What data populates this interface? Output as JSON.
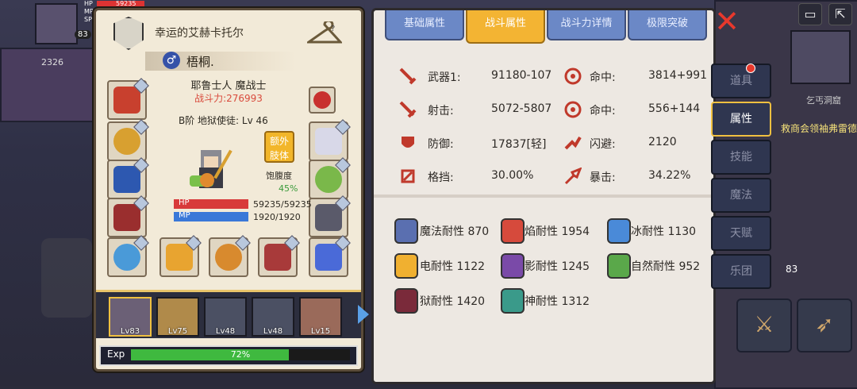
{
  "hud": {
    "hp_label": "HP",
    "mp_label": "MP",
    "sp_label": "SP",
    "hp_value": "59235",
    "level": "83",
    "coins": "2326"
  },
  "minimap": {
    "location": "乞丐洞窟",
    "quest": "救商会领袖弗雷德"
  },
  "character": {
    "title": "幸运的艾赫卡托尔",
    "gender_symbol": "♂",
    "name": "梧桐.",
    "race_class": "耶鲁士人 魔战士",
    "power": "战斗力:276993",
    "rank": "B阶 地狱使徒: Lv 46",
    "extra_button": [
      "额外",
      "肢体"
    ],
    "satiety_label": "饱腹度",
    "satiety_value": "45%",
    "hp_label": "HP",
    "hp": "59235/59235",
    "hp_ratio": 1.0,
    "mp_label": "MP",
    "mp": "1920/1920",
    "mp_ratio": 1.0
  },
  "party": {
    "members": [
      {
        "lv": "Lv83"
      },
      {
        "lv": "Lv75"
      },
      {
        "lv": "Lv48"
      },
      {
        "lv": "Lv48"
      },
      {
        "lv": "Lv15"
      }
    ]
  },
  "exp": {
    "label": "Exp",
    "percent": "72%",
    "ratio": 0.72
  },
  "tabs": [
    "基础属性",
    "战斗属性",
    "战斗力详情",
    "极限突破"
  ],
  "stats": [
    {
      "label": "武器1:",
      "value": "91180-107",
      "label2": "命中:",
      "value2": "3814+991"
    },
    {
      "label": "射击:",
      "value": "5072-5807",
      "label2": "命中:",
      "value2": "556+144"
    },
    {
      "label": "防御:",
      "value": "17837[轻]",
      "label2": "闪避:",
      "value2": "2120"
    },
    {
      "label": "格挡:",
      "value": "30.00%",
      "label2": "暴击:",
      "value2": "34.22%"
    }
  ],
  "resist": [
    {
      "text": "魔法耐性 870",
      "color": "#5a6fb0"
    },
    {
      "text": "焰耐性 1954",
      "color": "#d64a3c"
    },
    {
      "text": "冰耐性 1130",
      "color": "#4a8ad8"
    },
    {
      "text": "电耐性 1122",
      "color": "#f0b030"
    },
    {
      "text": "影耐性 1245",
      "color": "#7a4aa8"
    },
    {
      "text": "自然耐性 952",
      "color": "#5aa84a"
    },
    {
      "text": "狱耐性 1420",
      "color": "#7a2a3a"
    },
    {
      "text": "神耐性 1312",
      "color": "#3a9a8a"
    }
  ],
  "side_menu": [
    "道具",
    "属性",
    "技能",
    "魔法",
    "天赋",
    "乐团"
  ],
  "side_numbers": {
    "badge": "83"
  }
}
